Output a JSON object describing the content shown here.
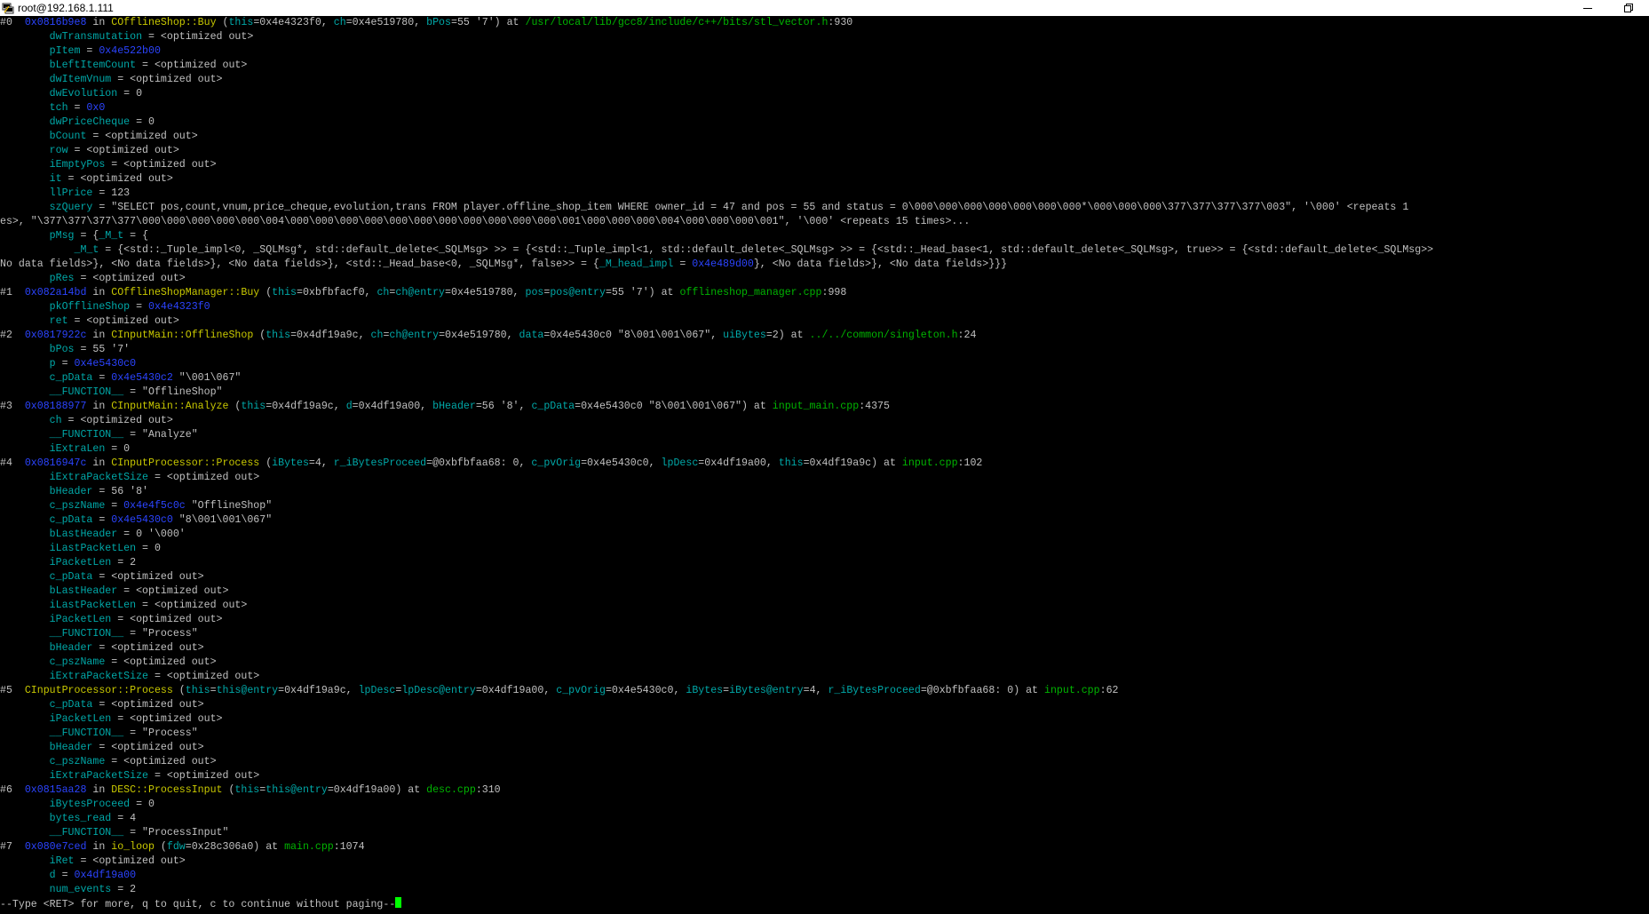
{
  "window": {
    "title": "root@192.168.1.111"
  },
  "terminal": {
    "lines": [
      [
        [
          "#0  ",
          ""
        ],
        [
          "0x0816b9e8",
          "addr"
        ],
        [
          " in ",
          ""
        ],
        [
          "COfflineShop::Buy",
          "fn"
        ],
        [
          " (",
          ""
        ],
        [
          "this",
          "var"
        ],
        [
          "=0x4e4323f0, ",
          ""
        ],
        [
          "ch",
          "var"
        ],
        [
          "=0x4e519780, ",
          ""
        ],
        [
          "bPos",
          "var"
        ],
        [
          "=55 '7') at ",
          ""
        ],
        [
          "/usr/local/lib/gcc8/include/c++/bits/stl_vector.h",
          "file"
        ],
        [
          ":930",
          ""
        ]
      ],
      [
        [
          "        ",
          ""
        ],
        [
          "dwTransmutation",
          "var"
        ],
        [
          " = <optimized out>",
          ""
        ]
      ],
      [
        [
          "        ",
          ""
        ],
        [
          "pItem",
          "var"
        ],
        [
          " = ",
          ""
        ],
        [
          "0x4e522b00",
          "addr"
        ]
      ],
      [
        [
          "        ",
          ""
        ],
        [
          "bLeftItemCount",
          "var"
        ],
        [
          " = <optimized out>",
          ""
        ]
      ],
      [
        [
          "        ",
          ""
        ],
        [
          "dwItemVnum",
          "var"
        ],
        [
          " = <optimized out>",
          ""
        ]
      ],
      [
        [
          "        ",
          ""
        ],
        [
          "dwEvolution",
          "var"
        ],
        [
          " = 0",
          ""
        ]
      ],
      [
        [
          "        ",
          ""
        ],
        [
          "tch",
          "var"
        ],
        [
          " = ",
          ""
        ],
        [
          "0x0",
          "addr"
        ]
      ],
      [
        [
          "        ",
          ""
        ],
        [
          "dwPriceCheque",
          "var"
        ],
        [
          " = 0",
          ""
        ]
      ],
      [
        [
          "        ",
          ""
        ],
        [
          "bCount",
          "var"
        ],
        [
          " = <optimized out>",
          ""
        ]
      ],
      [
        [
          "        ",
          ""
        ],
        [
          "row",
          "var"
        ],
        [
          " = <optimized out>",
          ""
        ]
      ],
      [
        [
          "        ",
          ""
        ],
        [
          "iEmptyPos",
          "var"
        ],
        [
          " = <optimized out>",
          ""
        ]
      ],
      [
        [
          "        ",
          ""
        ],
        [
          "it",
          "var"
        ],
        [
          " = <optimized out>",
          ""
        ]
      ],
      [
        [
          "        ",
          ""
        ],
        [
          "llPrice",
          "var"
        ],
        [
          " = 123",
          ""
        ]
      ],
      [
        [
          "        ",
          ""
        ],
        [
          "szQuery",
          "var"
        ],
        [
          " = \"SELECT pos,count,vnum,price_cheque,evolution,trans FROM player.offline_shop_item WHERE owner_id = 47 and pos = 55 and status = 0\\000\\000\\000\\000\\000\\000\\000*\\000\\000\\000\\377\\377\\377\\377\\003\", '\\000' <repeats 1",
          ""
        ]
      ],
      [
        [
          "es>, \"\\377\\377\\377\\377\\000\\000\\000\\000\\000\\004\\000\\000\\000\\000\\000\\000\\000\\000\\000\\000\\000\\001\\000\\000\\000\\004\\000\\000\\000\\001\", '\\000' <repeats 15 times>...",
          ""
        ]
      ],
      [
        [
          "        ",
          ""
        ],
        [
          "pMsg",
          "var"
        ],
        [
          " = {",
          ""
        ],
        [
          "_M_t",
          "var"
        ],
        [
          " = {",
          ""
        ]
      ],
      [
        [
          "            ",
          ""
        ],
        [
          "_M_t",
          "var"
        ],
        [
          " = {<std::_Tuple_impl<0, _SQLMsg*, std::default_delete<_SQLMsg> >> = {<std::_Tuple_impl<1, std::default_delete<_SQLMsg> >> = {<std::_Head_base<1, std::default_delete<_SQLMsg>, true>> = {<std::default_delete<_SQLMsg>>",
          ""
        ]
      ],
      [
        [
          "No data fields>}, <No data fields>}, <No data fields>}, <std::_Head_base<0, _SQLMsg*, false>> = {",
          ""
        ],
        [
          "_M_head_impl",
          "var"
        ],
        [
          " = ",
          ""
        ],
        [
          "0x4e489d00",
          "addr"
        ],
        [
          "}, <No data fields>}, <No data fields>}}}",
          ""
        ]
      ],
      [
        [
          "        ",
          ""
        ],
        [
          "pRes",
          "var"
        ],
        [
          " = <optimized out>",
          ""
        ]
      ],
      [
        [
          "#1  ",
          ""
        ],
        [
          "0x082a14bd",
          "addr"
        ],
        [
          " in ",
          ""
        ],
        [
          "COfflineShopManager::Buy",
          "fn"
        ],
        [
          " (",
          ""
        ],
        [
          "this",
          "var"
        ],
        [
          "=0xbfbfacf0, ",
          ""
        ],
        [
          "ch",
          "var"
        ],
        [
          "=",
          ""
        ],
        [
          "ch@entry",
          "var"
        ],
        [
          "=0x4e519780, ",
          ""
        ],
        [
          "pos",
          "var"
        ],
        [
          "=",
          ""
        ],
        [
          "pos@entry",
          "var"
        ],
        [
          "=55 '7') at ",
          ""
        ],
        [
          "offlineshop_manager.cpp",
          "file"
        ],
        [
          ":998",
          ""
        ]
      ],
      [
        [
          "        ",
          ""
        ],
        [
          "pkOfflineShop",
          "var"
        ],
        [
          " = ",
          ""
        ],
        [
          "0x4e4323f0",
          "addr"
        ]
      ],
      [
        [
          "        ",
          ""
        ],
        [
          "ret",
          "var"
        ],
        [
          " = <optimized out>",
          ""
        ]
      ],
      [
        [
          "#2  ",
          ""
        ],
        [
          "0x0817922c",
          "addr"
        ],
        [
          " in ",
          ""
        ],
        [
          "CInputMain::OfflineShop",
          "fn"
        ],
        [
          " (",
          ""
        ],
        [
          "this",
          "var"
        ],
        [
          "=0x4df19a9c, ",
          ""
        ],
        [
          "ch",
          "var"
        ],
        [
          "=",
          ""
        ],
        [
          "ch@entry",
          "var"
        ],
        [
          "=0x4e519780, ",
          ""
        ],
        [
          "data",
          "var"
        ],
        [
          "=0x4e5430c0 \"8\\001\\001\\067\", ",
          ""
        ],
        [
          "uiBytes",
          "var"
        ],
        [
          "=2) at ",
          ""
        ],
        [
          "../../common/singleton.h",
          "file"
        ],
        [
          ":24",
          ""
        ]
      ],
      [
        [
          "        ",
          ""
        ],
        [
          "bPos",
          "var"
        ],
        [
          " = 55 '7'",
          ""
        ]
      ],
      [
        [
          "        ",
          ""
        ],
        [
          "p",
          "var"
        ],
        [
          " = ",
          ""
        ],
        [
          "0x4e5430c0",
          "addr"
        ]
      ],
      [
        [
          "        ",
          ""
        ],
        [
          "c_pData",
          "var"
        ],
        [
          " = ",
          ""
        ],
        [
          "0x4e5430c2",
          "addr"
        ],
        [
          " \"\\001\\067\"",
          ""
        ]
      ],
      [
        [
          "        ",
          ""
        ],
        [
          "__FUNCTION__",
          "var"
        ],
        [
          " = \"OfflineShop\"",
          ""
        ]
      ],
      [
        [
          "#3  ",
          ""
        ],
        [
          "0x08188977",
          "addr"
        ],
        [
          " in ",
          ""
        ],
        [
          "CInputMain::Analyze",
          "fn"
        ],
        [
          " (",
          ""
        ],
        [
          "this",
          "var"
        ],
        [
          "=0x4df19a9c, ",
          ""
        ],
        [
          "d",
          "var"
        ],
        [
          "=0x4df19a00, ",
          ""
        ],
        [
          "bHeader",
          "var"
        ],
        [
          "=56 '8', ",
          ""
        ],
        [
          "c_pData",
          "var"
        ],
        [
          "=0x4e5430c0 \"8\\001\\001\\067\") at ",
          ""
        ],
        [
          "input_main.cpp",
          "file"
        ],
        [
          ":4375",
          ""
        ]
      ],
      [
        [
          "        ",
          ""
        ],
        [
          "ch",
          "var"
        ],
        [
          " = <optimized out>",
          ""
        ]
      ],
      [
        [
          "        ",
          ""
        ],
        [
          "__FUNCTION__",
          "var"
        ],
        [
          " = \"Analyze\"",
          ""
        ]
      ],
      [
        [
          "        ",
          ""
        ],
        [
          "iExtraLen",
          "var"
        ],
        [
          " = 0",
          ""
        ]
      ],
      [
        [
          "#4  ",
          ""
        ],
        [
          "0x0816947c",
          "addr"
        ],
        [
          " in ",
          ""
        ],
        [
          "CInputProcessor::Process",
          "fn"
        ],
        [
          " (",
          ""
        ],
        [
          "iBytes",
          "var"
        ],
        [
          "=4, ",
          ""
        ],
        [
          "r_iBytesProceed",
          "var"
        ],
        [
          "=@0xbfbfaa68: 0, ",
          ""
        ],
        [
          "c_pvOrig",
          "var"
        ],
        [
          "=0x4e5430c0, ",
          ""
        ],
        [
          "lpDesc",
          "var"
        ],
        [
          "=0x4df19a00, ",
          ""
        ],
        [
          "this",
          "var"
        ],
        [
          "=0x4df19a9c) at ",
          ""
        ],
        [
          "input.cpp",
          "file"
        ],
        [
          ":102",
          ""
        ]
      ],
      [
        [
          "        ",
          ""
        ],
        [
          "iExtraPacketSize",
          "var"
        ],
        [
          " = <optimized out>",
          ""
        ]
      ],
      [
        [
          "        ",
          ""
        ],
        [
          "bHeader",
          "var"
        ],
        [
          " = 56 '8'",
          ""
        ]
      ],
      [
        [
          "        ",
          ""
        ],
        [
          "c_pszName",
          "var"
        ],
        [
          " = ",
          ""
        ],
        [
          "0x4e4f5c0c",
          "addr"
        ],
        [
          " \"OfflineShop\"",
          ""
        ]
      ],
      [
        [
          "        ",
          ""
        ],
        [
          "c_pData",
          "var"
        ],
        [
          " = ",
          ""
        ],
        [
          "0x4e5430c0",
          "addr"
        ],
        [
          " \"8\\001\\001\\067\"",
          ""
        ]
      ],
      [
        [
          "        ",
          ""
        ],
        [
          "bLastHeader",
          "var"
        ],
        [
          " = 0 '\\000'",
          ""
        ]
      ],
      [
        [
          "        ",
          ""
        ],
        [
          "iLastPacketLen",
          "var"
        ],
        [
          " = 0",
          ""
        ]
      ],
      [
        [
          "        ",
          ""
        ],
        [
          "iPacketLen",
          "var"
        ],
        [
          " = 2",
          ""
        ]
      ],
      [
        [
          "        ",
          ""
        ],
        [
          "c_pData",
          "var"
        ],
        [
          " = <optimized out>",
          ""
        ]
      ],
      [
        [
          "        ",
          ""
        ],
        [
          "bLastHeader",
          "var"
        ],
        [
          " = <optimized out>",
          ""
        ]
      ],
      [
        [
          "        ",
          ""
        ],
        [
          "iLastPacketLen",
          "var"
        ],
        [
          " = <optimized out>",
          ""
        ]
      ],
      [
        [
          "        ",
          ""
        ],
        [
          "iPacketLen",
          "var"
        ],
        [
          " = <optimized out>",
          ""
        ]
      ],
      [
        [
          "        ",
          ""
        ],
        [
          "__FUNCTION__",
          "var"
        ],
        [
          " = \"Process\"",
          ""
        ]
      ],
      [
        [
          "        ",
          ""
        ],
        [
          "bHeader",
          "var"
        ],
        [
          " = <optimized out>",
          ""
        ]
      ],
      [
        [
          "        ",
          ""
        ],
        [
          "c_pszName",
          "var"
        ],
        [
          " = <optimized out>",
          ""
        ]
      ],
      [
        [
          "        ",
          ""
        ],
        [
          "iExtraPacketSize",
          "var"
        ],
        [
          " = <optimized out>",
          ""
        ]
      ],
      [
        [
          "#5  ",
          ""
        ],
        [
          "CInputProcessor::Process",
          "fn"
        ],
        [
          " (",
          ""
        ],
        [
          "this",
          "var"
        ],
        [
          "=",
          ""
        ],
        [
          "this@entry",
          "var"
        ],
        [
          "=0x4df19a9c, ",
          ""
        ],
        [
          "lpDesc",
          "var"
        ],
        [
          "=",
          ""
        ],
        [
          "lpDesc@entry",
          "var"
        ],
        [
          "=0x4df19a00, ",
          ""
        ],
        [
          "c_pvOrig",
          "var"
        ],
        [
          "=0x4e5430c0, ",
          ""
        ],
        [
          "iBytes",
          "var"
        ],
        [
          "=",
          ""
        ],
        [
          "iBytes@entry",
          "var"
        ],
        [
          "=4, ",
          ""
        ],
        [
          "r_iBytesProceed",
          "var"
        ],
        [
          "=@0xbfbfaa68: 0) at ",
          ""
        ],
        [
          "input.cpp",
          "file"
        ],
        [
          ":62",
          ""
        ]
      ],
      [
        [
          "        ",
          ""
        ],
        [
          "c_pData",
          "var"
        ],
        [
          " = <optimized out>",
          ""
        ]
      ],
      [
        [
          "        ",
          ""
        ],
        [
          "iPacketLen",
          "var"
        ],
        [
          " = <optimized out>",
          ""
        ]
      ],
      [
        [
          "        ",
          ""
        ],
        [
          "__FUNCTION__",
          "var"
        ],
        [
          " = \"Process\"",
          ""
        ]
      ],
      [
        [
          "        ",
          ""
        ],
        [
          "bHeader",
          "var"
        ],
        [
          " = <optimized out>",
          ""
        ]
      ],
      [
        [
          "        ",
          ""
        ],
        [
          "c_pszName",
          "var"
        ],
        [
          " = <optimized out>",
          ""
        ]
      ],
      [
        [
          "        ",
          ""
        ],
        [
          "iExtraPacketSize",
          "var"
        ],
        [
          " = <optimized out>",
          ""
        ]
      ],
      [
        [
          "#6  ",
          ""
        ],
        [
          "0x0815aa28",
          "addr"
        ],
        [
          " in ",
          ""
        ],
        [
          "DESC::ProcessInput",
          "fn"
        ],
        [
          " (",
          ""
        ],
        [
          "this",
          "var"
        ],
        [
          "=",
          ""
        ],
        [
          "this@entry",
          "var"
        ],
        [
          "=0x4df19a00) at ",
          ""
        ],
        [
          "desc.cpp",
          "file"
        ],
        [
          ":310",
          ""
        ]
      ],
      [
        [
          "        ",
          ""
        ],
        [
          "iBytesProceed",
          "var"
        ],
        [
          " = 0",
          ""
        ]
      ],
      [
        [
          "        ",
          ""
        ],
        [
          "bytes_read",
          "var"
        ],
        [
          " = 4",
          ""
        ]
      ],
      [
        [
          "        ",
          ""
        ],
        [
          "__FUNCTION__",
          "var"
        ],
        [
          " = \"ProcessInput\"",
          ""
        ]
      ],
      [
        [
          "#7  ",
          ""
        ],
        [
          "0x080e7ced",
          "addr"
        ],
        [
          " in ",
          ""
        ],
        [
          "io_loop",
          "fn"
        ],
        [
          " (",
          ""
        ],
        [
          "fdw",
          "var"
        ],
        [
          "=0x28c306a0) at ",
          ""
        ],
        [
          "main.cpp",
          "file"
        ],
        [
          ":1074",
          ""
        ]
      ],
      [
        [
          "        ",
          ""
        ],
        [
          "iRet",
          "var"
        ],
        [
          " = <optimized out>",
          ""
        ]
      ],
      [
        [
          "        ",
          ""
        ],
        [
          "d",
          "var"
        ],
        [
          " = ",
          ""
        ],
        [
          "0x4df19a00",
          "addr"
        ]
      ],
      [
        [
          "        ",
          ""
        ],
        [
          "num_events",
          "var"
        ],
        [
          " = 2",
          ""
        ]
      ]
    ],
    "prompt": "--Type <RET> for more, q to quit, c to continue without paging--"
  }
}
